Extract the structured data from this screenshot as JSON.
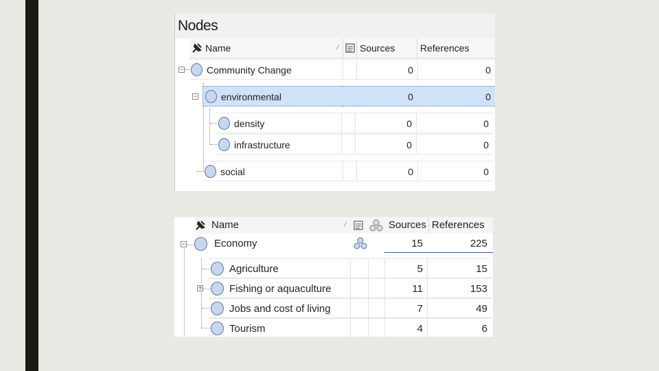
{
  "panel1": {
    "title": "Nodes",
    "columns": {
      "name": "Name",
      "sources": "Sources",
      "references": "References"
    },
    "rows": [
      {
        "name": "Community Change",
        "sources": "0",
        "references": "0"
      },
      {
        "name": "environmental",
        "sources": "0",
        "references": "0",
        "selected": true
      },
      {
        "name": "density",
        "sources": "0",
        "references": "0"
      },
      {
        "name": "infrastructure",
        "sources": "0",
        "references": "0"
      },
      {
        "name": "social",
        "sources": "0",
        "references": "0"
      }
    ]
  },
  "panel2": {
    "columns": {
      "name": "Name",
      "sources": "Sources",
      "references": "References"
    },
    "rows": [
      {
        "name": "Economy",
        "sources": "15",
        "references": "225"
      },
      {
        "name": "Agriculture",
        "sources": "5",
        "references": "15"
      },
      {
        "name": "Fishing or aquaculture",
        "sources": "11",
        "references": "153"
      },
      {
        "name": "Jobs and cost of living",
        "sources": "7",
        "references": "49"
      },
      {
        "name": "Tourism",
        "sources": "4",
        "references": "6"
      }
    ]
  },
  "colors": {
    "selection": "#cfe2f8",
    "node_icon_fill": "#c7d7ee",
    "node_icon_stroke": "#5574a6",
    "left_bar": "#1c1c14"
  },
  "icons": [
    "pin-icon",
    "memo-icon",
    "relationship-icon",
    "node-icon",
    "collapse-icon",
    "expand-icon"
  ]
}
